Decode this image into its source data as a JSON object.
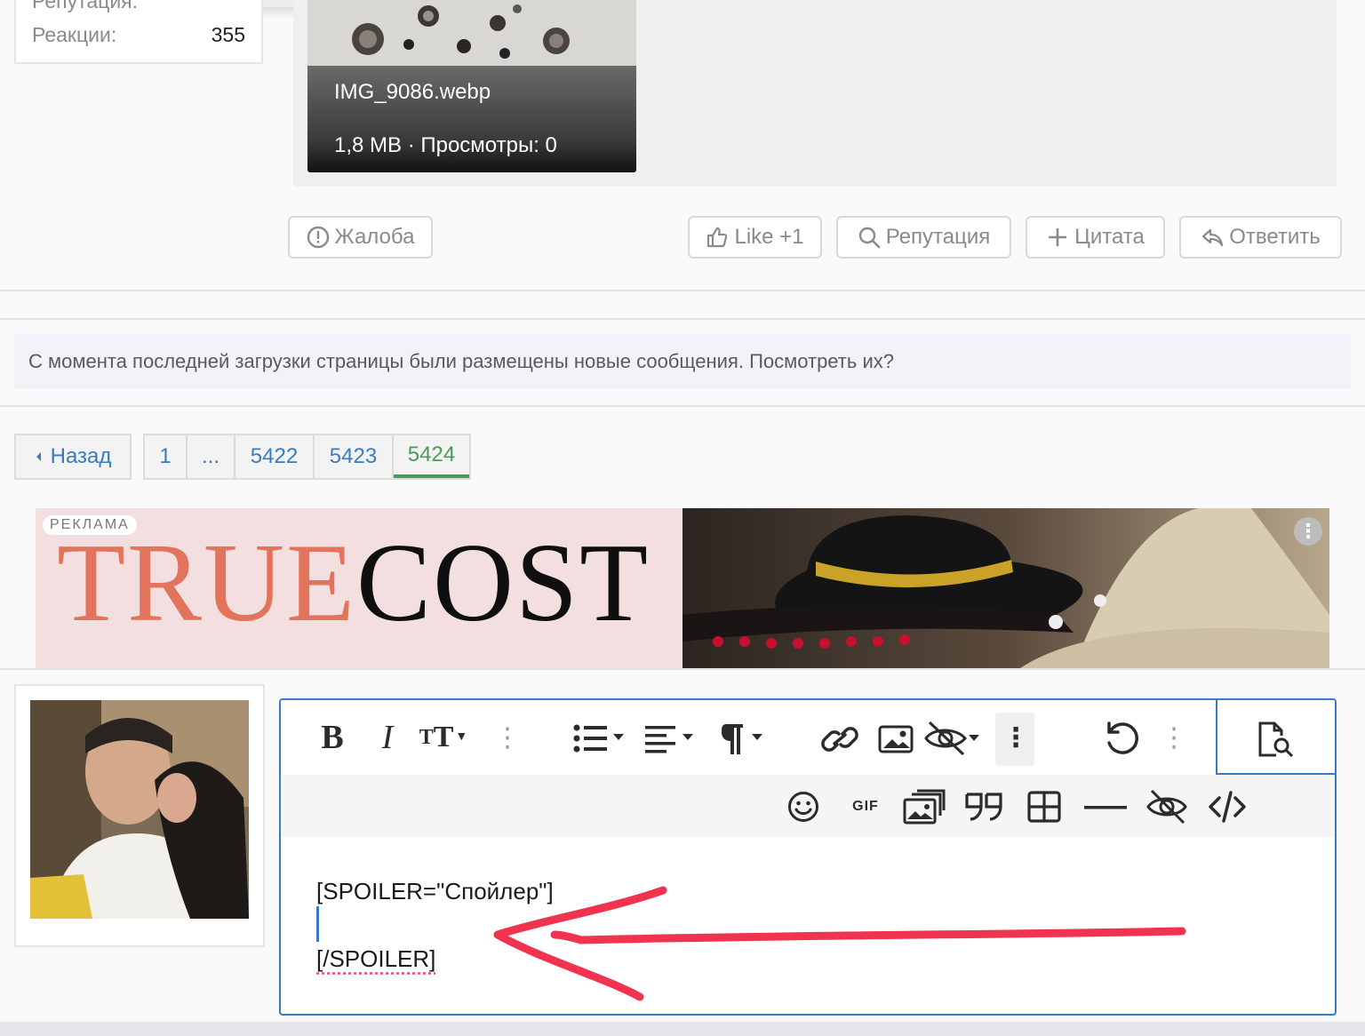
{
  "user_info": {
    "rep_label": "Репутация:",
    "reactions_label": "Реакции:",
    "reactions_value": "355"
  },
  "attachment": {
    "filename": "IMG_9086.webp",
    "meta": "1,8 MB · Просмотры: 0"
  },
  "actions": {
    "report": "Жалоба",
    "like": "Like +1",
    "reputation": "Репутация",
    "quote": "Цитата",
    "reply": "Ответить"
  },
  "notice": {
    "text": "С момента последней загрузки страницы были размещены новые сообщения. Посмотреть их?"
  },
  "pagination": {
    "back": "Назад",
    "pages": [
      "1",
      "...",
      "5422",
      "5423",
      "5424"
    ],
    "current": "5424"
  },
  "ad": {
    "label": "РЕКЛАМА",
    "logo_part1": "TRUE",
    "logo_part2": "COST",
    "menu": "⋮"
  },
  "editor": {
    "toolbar_row1": [
      "bold-icon",
      "italic-icon",
      "text-size-icon",
      "more-vertical-icon",
      "list-icon",
      "align-icon",
      "paragraph-icon",
      "link-icon",
      "image-icon",
      "hide-icon",
      "more-vertical-icon",
      "undo-icon",
      "more-vertical-icon",
      "preview-icon"
    ],
    "toolbar_row2": [
      "smile-icon",
      "gif-icon",
      "media-icon",
      "quote-icon",
      "table-icon",
      "hr-icon",
      "spoiler-icon",
      "code-icon"
    ],
    "gif_label": "GIF",
    "line1": "[SPOILER=\"Спойлер\"]",
    "line3": "[/SPOILER]"
  },
  "colors": {
    "accent": "#3a7bbf",
    "current_page": "#4b9a55",
    "annotation_arrow": "#f0334f"
  }
}
